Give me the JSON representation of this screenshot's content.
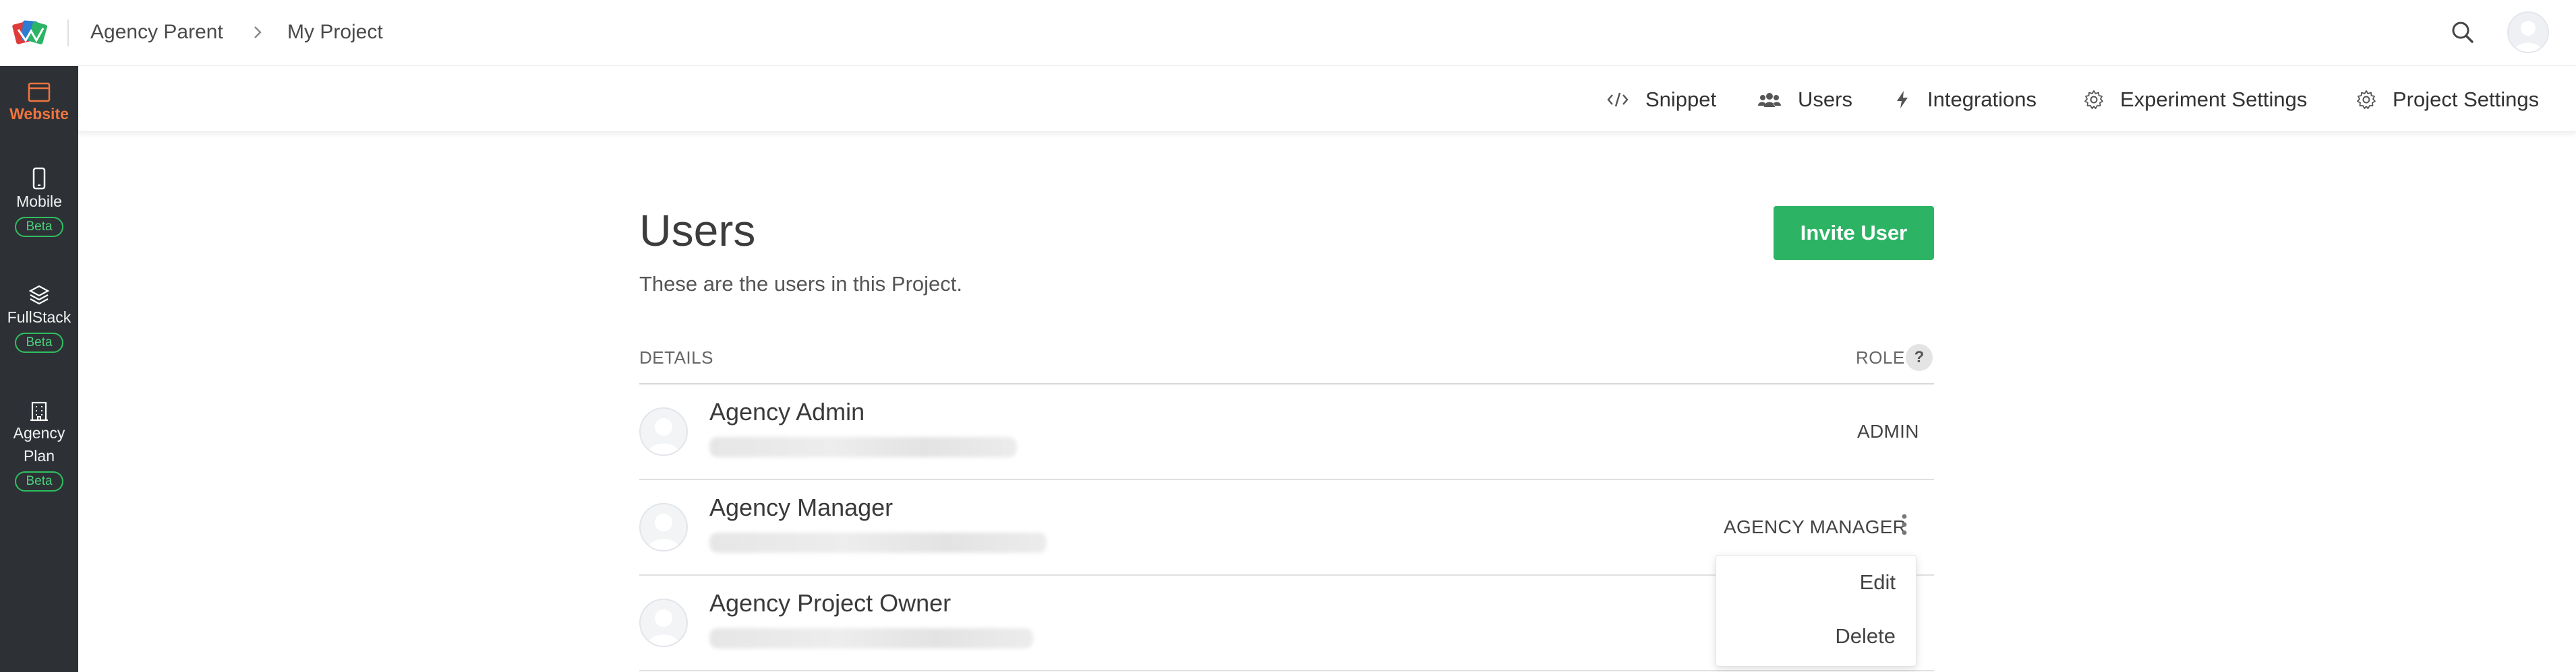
{
  "header": {
    "breadcrumb": [
      "Agency Parent",
      "My Project"
    ]
  },
  "sidebar": {
    "items": [
      {
        "label": "Website",
        "active": true,
        "icon": "browser-window-icon"
      },
      {
        "label": "Mobile",
        "badge": "Beta",
        "icon": "mobile-phone-icon"
      },
      {
        "label": "FullStack",
        "badge": "Beta",
        "icon": "layers-icon"
      },
      {
        "label": "Agency Plan",
        "badge": "Beta",
        "icon": "building-icon"
      }
    ]
  },
  "subnav": {
    "items": [
      {
        "label": "Snippet",
        "icon": "code-icon"
      },
      {
        "label": "Users",
        "icon": "users-icon"
      },
      {
        "label": "Integrations",
        "icon": "lightning-icon"
      },
      {
        "label": "Experiment Settings",
        "icon": "gear-icon"
      },
      {
        "label": "Project Settings",
        "icon": "gear-icon"
      }
    ]
  },
  "main": {
    "title": "Users",
    "subtitle": "These are the users in this Project.",
    "invite_label": "Invite User",
    "columns": {
      "details": "DETAILS",
      "role": "ROLE",
      "role_help": "?"
    }
  },
  "users": [
    {
      "name": "Agency Admin",
      "role": "ADMIN"
    },
    {
      "name": "Agency Manager",
      "role": "AGENCY MANAGER"
    },
    {
      "name": "Agency Project Owner",
      "role": ""
    }
  ],
  "menu": {
    "items": [
      "Edit",
      "Delete"
    ]
  },
  "colors": {
    "accent_orange": "#f0743e",
    "invite_green": "#2cb464",
    "beta_green": "#2fbf5e",
    "sidebar_bg": "#2d3136"
  }
}
